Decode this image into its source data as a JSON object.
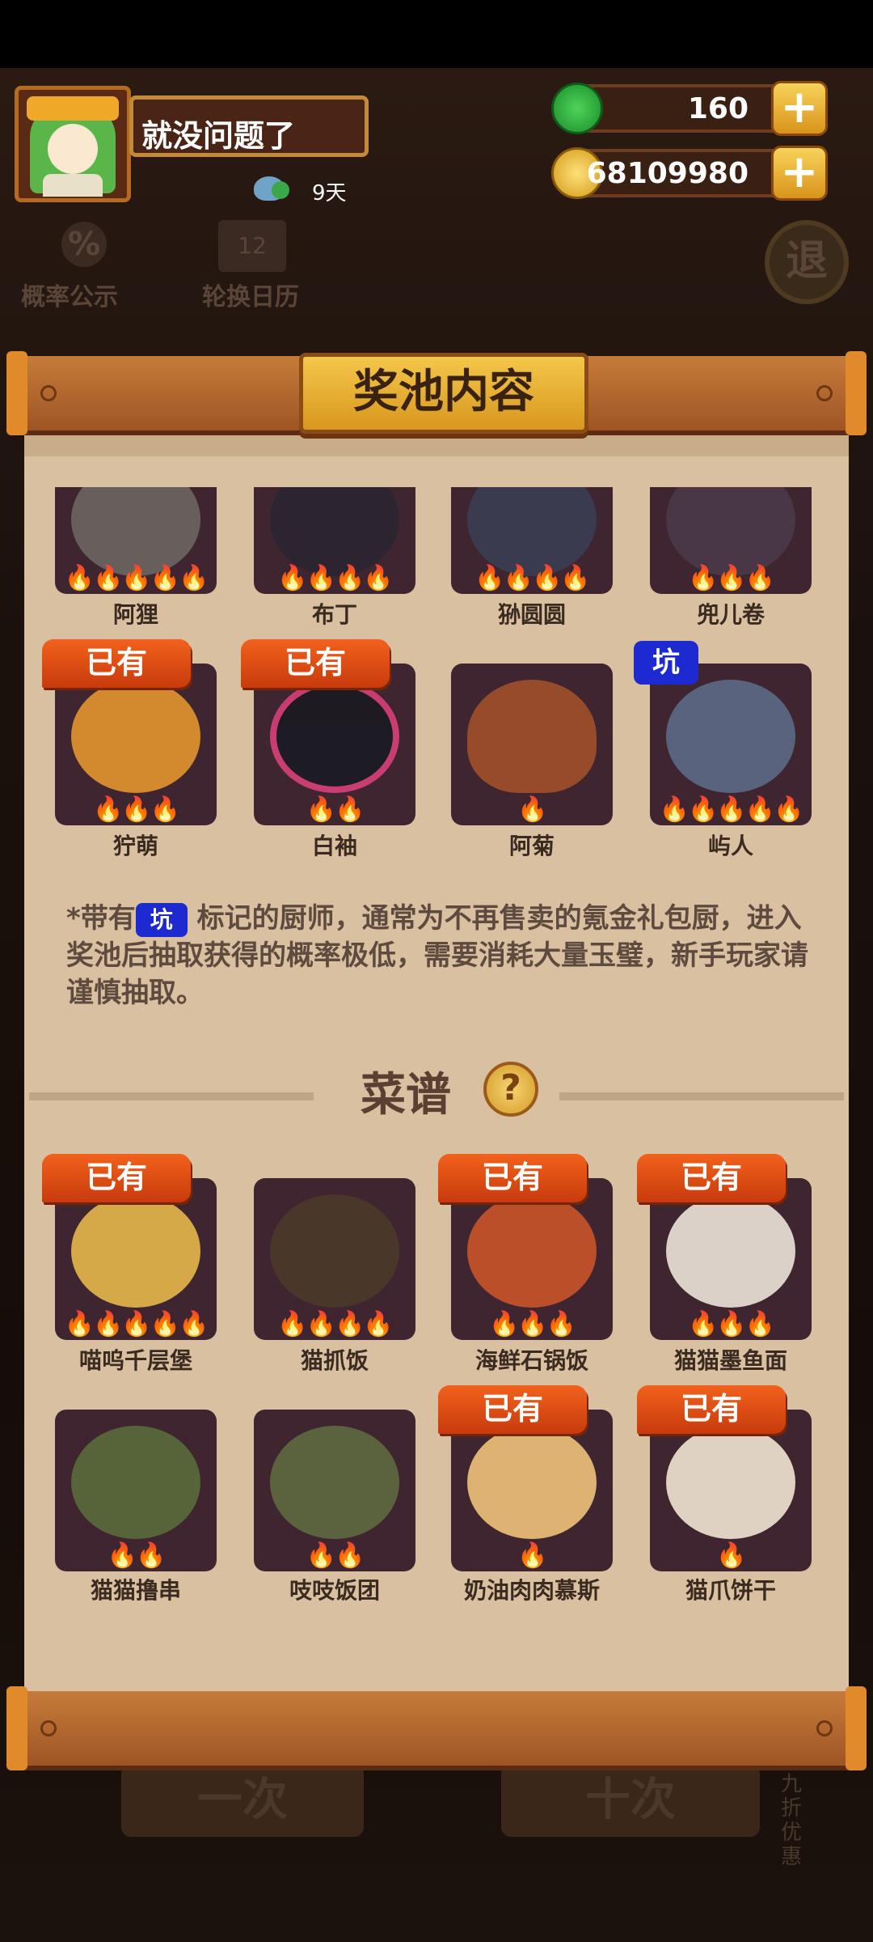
{
  "player": {
    "name": "就没问题了",
    "days": "9天"
  },
  "currency": {
    "jade": "160",
    "coins": "68109980",
    "plus": "+"
  },
  "menu": {
    "probability_label": "概率公示",
    "calendar_label": "轮换日历",
    "exit_label": "退",
    "percent": "%",
    "calendar_num": "12"
  },
  "dialog": {
    "title": "奖池内容",
    "owned_label": "已有",
    "pit_label": "坑",
    "note_prefix": "*带有",
    "note_suffix": "标记的厨师，通常为不再售卖的氪金礼包厨，进入奖池后抽取获得的概率极低，需要消耗大量玉璧，新手玩家请谨慎抽取。",
    "recipes_title": "菜谱",
    "help": "?"
  },
  "chefs_row1": [
    {
      "name": "阿狸",
      "flames": "🔥🔥🔥🔥🔥"
    },
    {
      "name": "布丁",
      "flames": "🔥🔥🔥🔥"
    },
    {
      "name": "狲圆圆",
      "flames": "🔥🔥🔥🔥"
    },
    {
      "name": "兜儿卷",
      "flames": "🔥🔥🔥"
    }
  ],
  "chefs_row2": [
    {
      "name": "狞萌",
      "flames": "🔥🔥🔥"
    },
    {
      "name": "白袖",
      "flames": "🔥🔥"
    },
    {
      "name": "阿菊",
      "flames": "🔥"
    },
    {
      "name": "屿人",
      "flames": "🔥🔥🔥🔥🔥"
    }
  ],
  "recipes_row1": [
    {
      "name": "喵呜千层堡",
      "flames": "🔥🔥🔥🔥🔥"
    },
    {
      "name": "猫抓饭",
      "flames": "🔥🔥🔥🔥"
    },
    {
      "name": "海鲜石锅饭",
      "flames": "🔥🔥🔥"
    },
    {
      "name": "猫猫墨鱼面",
      "flames": "🔥🔥🔥"
    }
  ],
  "recipes_row2": [
    {
      "name": "猫猫撸串",
      "flames": "🔥🔥"
    },
    {
      "name": "吱吱饭团",
      "flames": "🔥🔥"
    },
    {
      "name": "奶油肉肉慕斯",
      "flames": "🔥"
    },
    {
      "name": "猫爪饼干",
      "flames": "🔥"
    }
  ],
  "bottom": {
    "single": "一次",
    "ten": "十次",
    "discount": "九折优惠"
  },
  "colors": {
    "owned": "#e4541a",
    "pit": "#1d2ad0",
    "paper": "#d9c0a0",
    "flame": "#ff6a1a"
  }
}
